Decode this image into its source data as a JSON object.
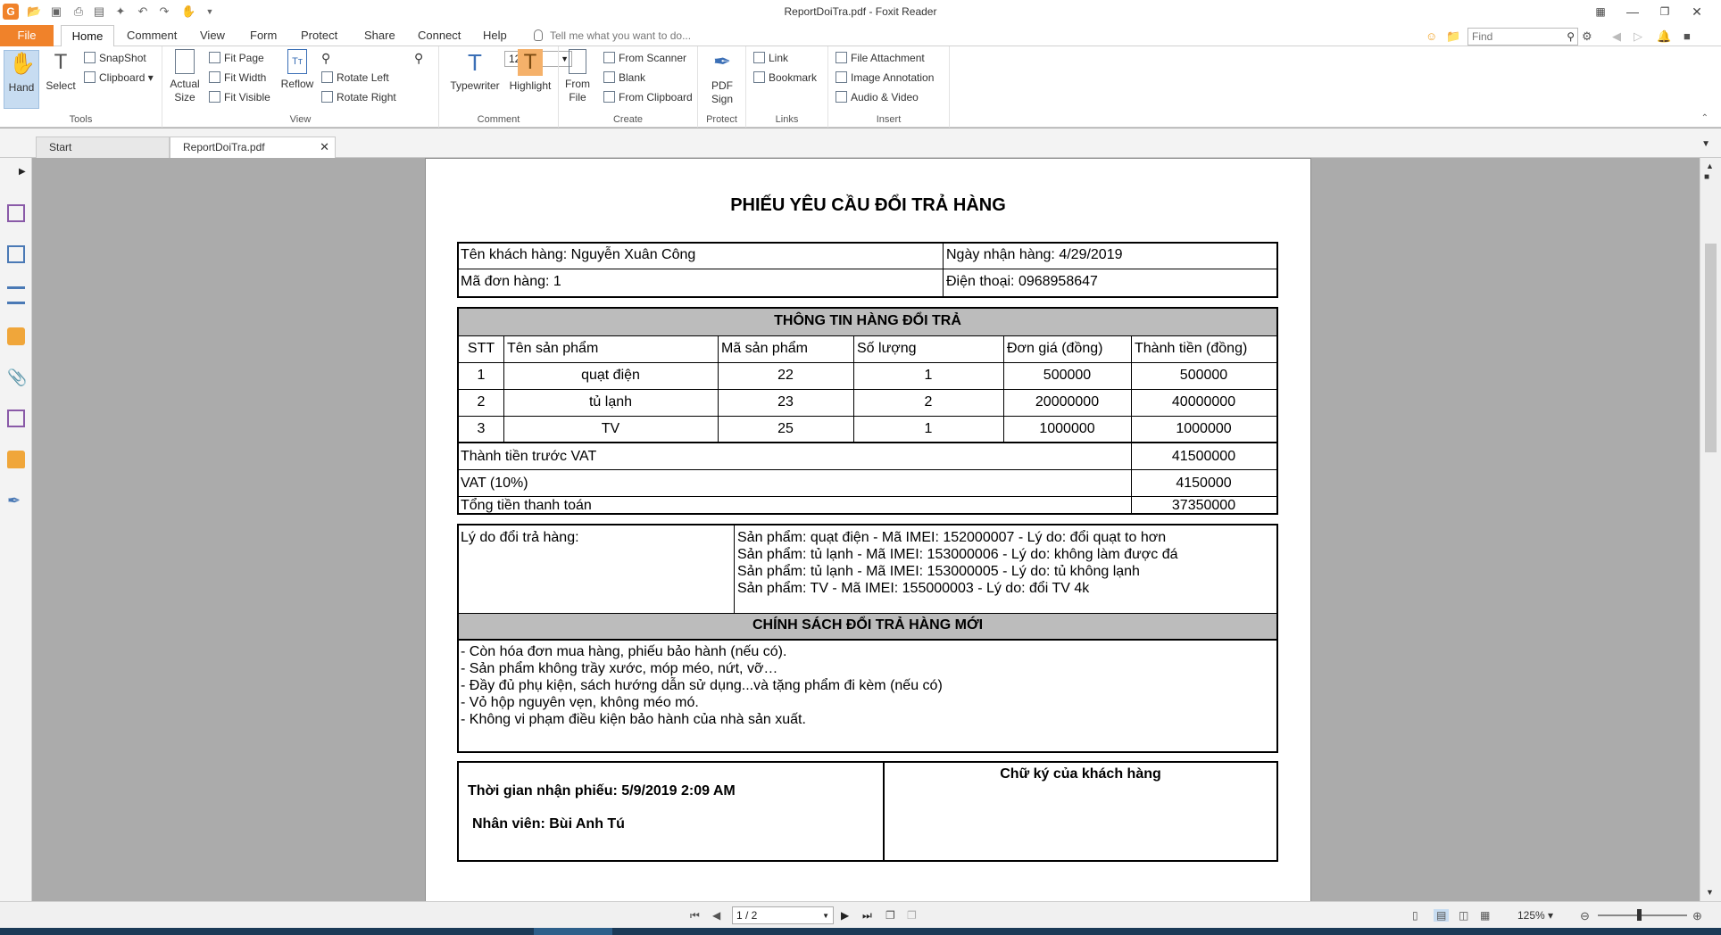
{
  "window": {
    "title": "ReportDoiTra.pdf - Foxit Reader"
  },
  "menu": {
    "tabs": [
      "File",
      "Home",
      "Comment",
      "View",
      "Form",
      "Protect",
      "Share",
      "Connect",
      "Help"
    ],
    "tell_me": "Tell me what you want to do...",
    "find_placeholder": "Find"
  },
  "ribbon": {
    "tools": {
      "hand": "Hand",
      "select": "Select",
      "snapshot": "SnapShot",
      "clipboard": "Clipboard",
      "group": "Tools"
    },
    "view": {
      "actual_size_1": "Actual",
      "actual_size_2": "Size",
      "fit_page": "Fit Page",
      "fit_width": "Fit Width",
      "fit_visible": "Fit Visible",
      "reflow": "Reflow",
      "zoom": "125%",
      "rotate_left": "Rotate Left",
      "rotate_right": "Rotate Right",
      "group": "View"
    },
    "comment": {
      "typewriter": "Typewriter",
      "highlight": "Highlight",
      "group": "Comment"
    },
    "create": {
      "from_file_1": "From",
      "from_file_2": "File",
      "from_scanner": "From Scanner",
      "blank": "Blank",
      "from_clipboard": "From Clipboard",
      "group": "Create"
    },
    "protect": {
      "pdf_sign_1": "PDF",
      "pdf_sign_2": "Sign",
      "group": "Protect"
    },
    "links": {
      "link": "Link",
      "bookmark": "Bookmark",
      "group": "Links"
    },
    "insert": {
      "file_attachment": "File Attachment",
      "image_annotation": "Image Annotation",
      "audio_video": "Audio & Video",
      "group": "Insert"
    }
  },
  "doc_tabs": [
    "Start",
    "ReportDoiTra.pdf"
  ],
  "document": {
    "title": "PHIẾU YÊU CẦU ĐỔI TRẢ HÀNG",
    "customer": "Tên khách hàng: Nguyễn Xuân Công",
    "received_date": "Ngày nhận hàng: 4/29/2019",
    "order_id": "Mã đơn hàng: 1",
    "phone": "Điện thoại: 0968958647",
    "items_header": "THÔNG TIN HÀNG ĐỔI TRẢ",
    "columns": [
      "STT",
      "Tên sản phẩm",
      "Mã sản phẩm",
      "Số lượng",
      "Đơn giá (đồng)",
      "Thành tiền (đồng)"
    ],
    "rows": [
      [
        "1",
        "quạt điện",
        "22",
        "1",
        "500000",
        "500000"
      ],
      [
        "2",
        "tủ lạnh",
        "23",
        "2",
        "20000000",
        "40000000"
      ],
      [
        "3",
        "TV",
        "25",
        "1",
        "1000000",
        "1000000"
      ]
    ],
    "subtotal_label": "Thành tiền trước VAT",
    "subtotal": "41500000",
    "vat_label": "VAT (10%)",
    "vat": "4150000",
    "total_label": "Tổng tiền thanh toán",
    "total": "37350000",
    "reason_label": "Lý do đổi trả hàng:",
    "reasons": [
      "Sản phẩm: quạt điện - Mã IMEI:  152000007     - Lý do:  đổi quạt to hơn",
      "Sản phẩm: tủ lạnh - Mã IMEI:  153000006 - Lý do:  không làm được đá",
      "Sản phẩm: tủ lạnh - Mã IMEI:  153000005 - Lý do:  tủ không lạnh",
      "Sản phẩm: TV - Mã IMEI:  155000003     - Lý do:  đổi TV 4k"
    ],
    "policy_header": "CHÍNH SÁCH ĐỔI TRẢ HÀNG MỚI",
    "policies": [
      "- Còn hóa đơn mua hàng, phiếu bảo hành (nếu có).",
      "- Sản phẩm không trầy xước, móp méo, nứt, vỡ…",
      "- Đầy đủ phụ kiện, sách hướng dẫn sử dụng...và tặng phẩm đi kèm (nếu có)",
      "- Vỏ hộp nguyên vẹn, không méo mó.",
      "- Không vi phạm điều kiện bảo hành của nhà sản xuất."
    ],
    "received_time": "Thời gian nhận phiếu: 5/9/2019 2:09 AM",
    "staff": "Nhân viên: Bùi Anh Tú",
    "signature_label": "Chữ ký của khách hàng"
  },
  "status": {
    "page": "1 / 2",
    "zoom": "125%"
  },
  "colors": {
    "file_tab": "#f0822a",
    "hand_active": "#c7dcf1",
    "highlight_icon": "#f5b16a",
    "grey_band": "#bcbcbc"
  }
}
